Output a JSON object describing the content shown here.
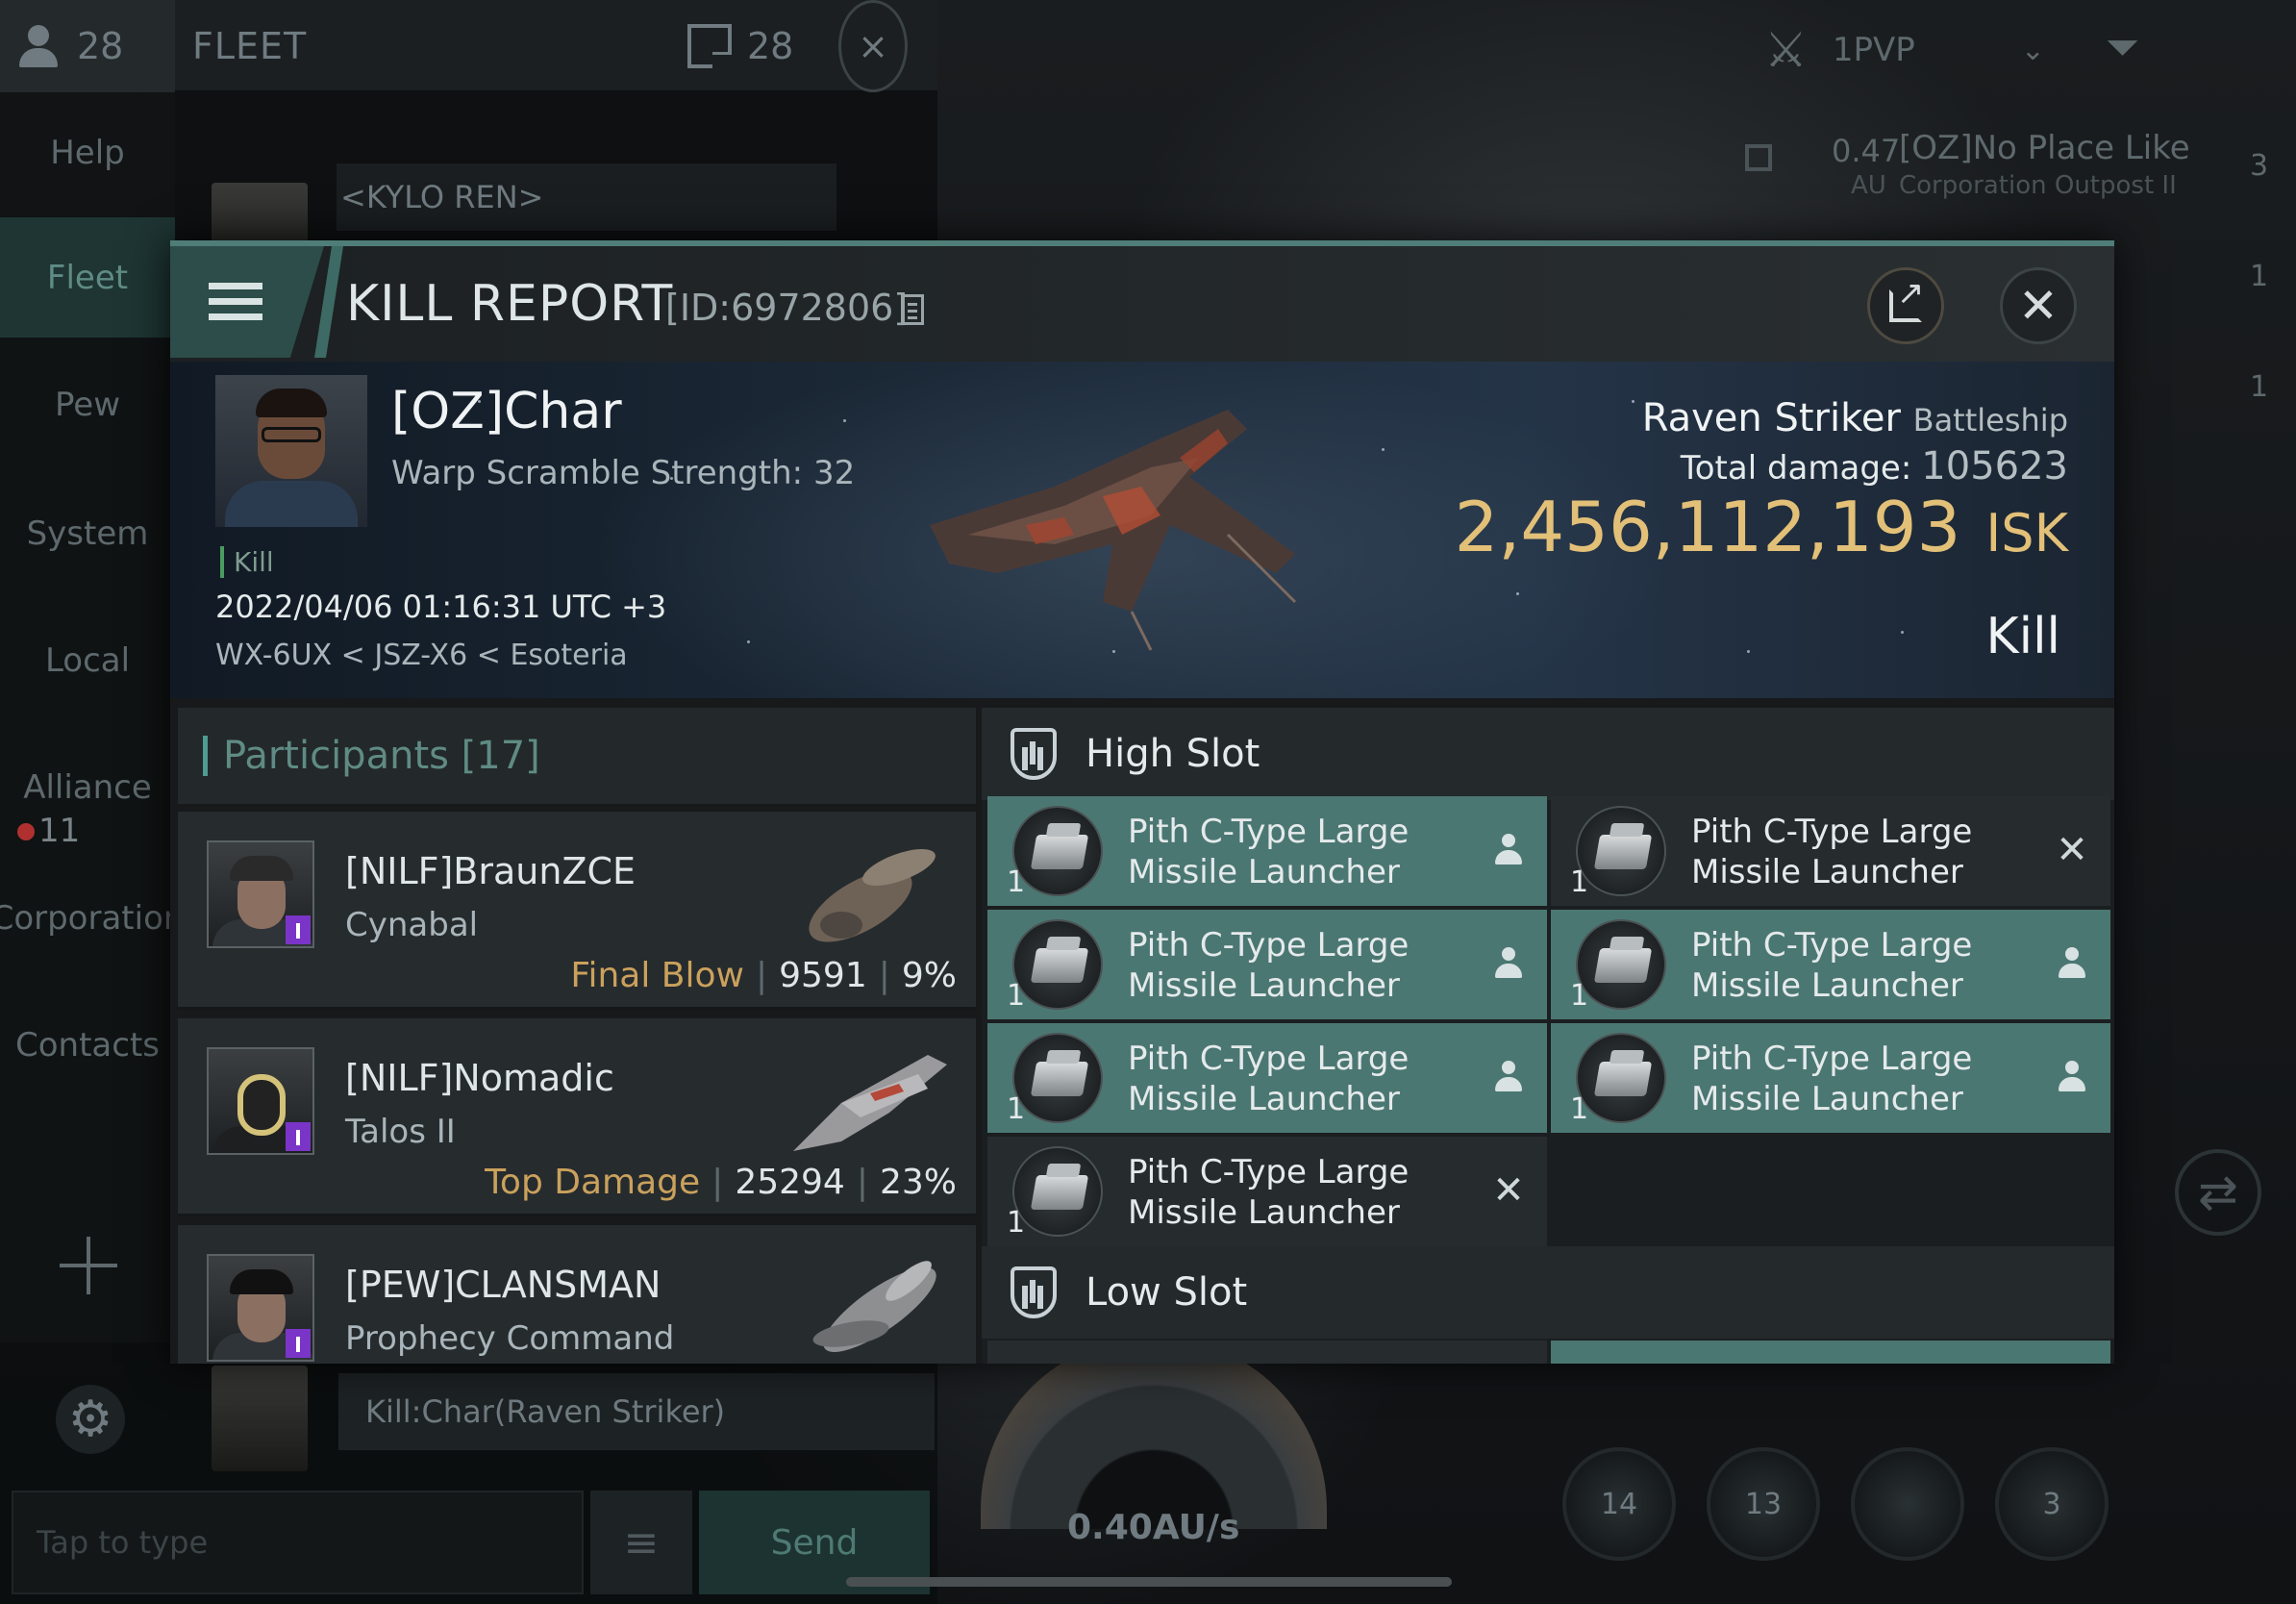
{
  "fleet": {
    "member_count": "28",
    "title": "FLEET",
    "box_count": "28",
    "close_icon": "close-icon"
  },
  "sidebar": {
    "items": [
      {
        "label": "Help"
      },
      {
        "label": "Fleet"
      },
      {
        "label": "Pew"
      },
      {
        "label": "System"
      },
      {
        "label": "Local"
      },
      {
        "label": "Alliance"
      },
      {
        "label": "Corporation"
      },
      {
        "label": "Contacts"
      }
    ],
    "alliance_unread": "11"
  },
  "chat": {
    "kylo_message": "<KYLO REN>",
    "kill_message": "Kill:Char(Raven Striker)",
    "input_placeholder": "Tap to type",
    "send_label": "Send"
  },
  "hud": {
    "pvp_filter": "1PVP",
    "overview": {
      "distance": "0.47",
      "unit": "AU",
      "name": "[OZ]No Place Like",
      "subtitle": "Corporation Outpost II"
    },
    "badges": [
      "3",
      "1",
      "1"
    ],
    "speed": "0.40AU/s",
    "module_counts": [
      "14",
      "13",
      "3"
    ]
  },
  "kill_report": {
    "title": "KILL REPORT",
    "id_text": "[ID:6972806]",
    "victim": {
      "name": "[OZ]Char",
      "scram": "Warp Scramble Strength: 32",
      "tag": "Kill",
      "time": "2022/04/06 01:16:31 UTC +3",
      "location": "WX-6UX < JSZ-X6 < Esoteria"
    },
    "ship": {
      "name": "Raven Striker",
      "class": "Battleship",
      "total_damage_label": "Total damage:",
      "total_damage": "105623",
      "isk_value": "2,456,112,193",
      "isk_unit": "ISK",
      "result": "Kill"
    },
    "participants": {
      "header": "Participants [17]",
      "rows": [
        {
          "name": "[NILF]BraunZCE",
          "ship": "Cynabal",
          "label": "Final Blow",
          "damage": "9591",
          "percent": "9%"
        },
        {
          "name": "[NILF]Nomadic",
          "ship": "Talos II",
          "label": "Top Damage",
          "damage": "25294",
          "percent": "23%"
        },
        {
          "name": "[PEW]CLANSMAN",
          "ship": "Prophecy Command",
          "label": "",
          "damage": "",
          "percent": ""
        }
      ]
    },
    "slots": {
      "high_label": "High Slot",
      "low_label": "Low Slot",
      "high_items": [
        {
          "qty": "1",
          "line1": "Pith C-Type Large",
          "line2": "Missile Launcher",
          "status": "dropped"
        },
        {
          "qty": "1",
          "line1": "Pith C-Type Large",
          "line2": "Missile Launcher",
          "status": "destroyed"
        },
        {
          "qty": "1",
          "line1": "Pith C-Type Large",
          "line2": "Missile Launcher",
          "status": "dropped"
        },
        {
          "qty": "1",
          "line1": "Pith C-Type Large",
          "line2": "Missile Launcher",
          "status": "dropped"
        },
        {
          "qty": "1",
          "line1": "Pith C-Type Large",
          "line2": "Missile Launcher",
          "status": "dropped"
        },
        {
          "qty": "1",
          "line1": "Pith C-Type Large",
          "line2": "Missile Launcher",
          "status": "dropped"
        },
        {
          "qty": "1",
          "line1": "Pith C-Type Large",
          "line2": "Missile Launcher",
          "status": "destroyed"
        }
      ]
    }
  },
  "colors": {
    "accent": "#4f7d78",
    "dropped_slot": "#4b7773",
    "isk_gold": "#e3c078",
    "label_gold": "#caa15c"
  }
}
